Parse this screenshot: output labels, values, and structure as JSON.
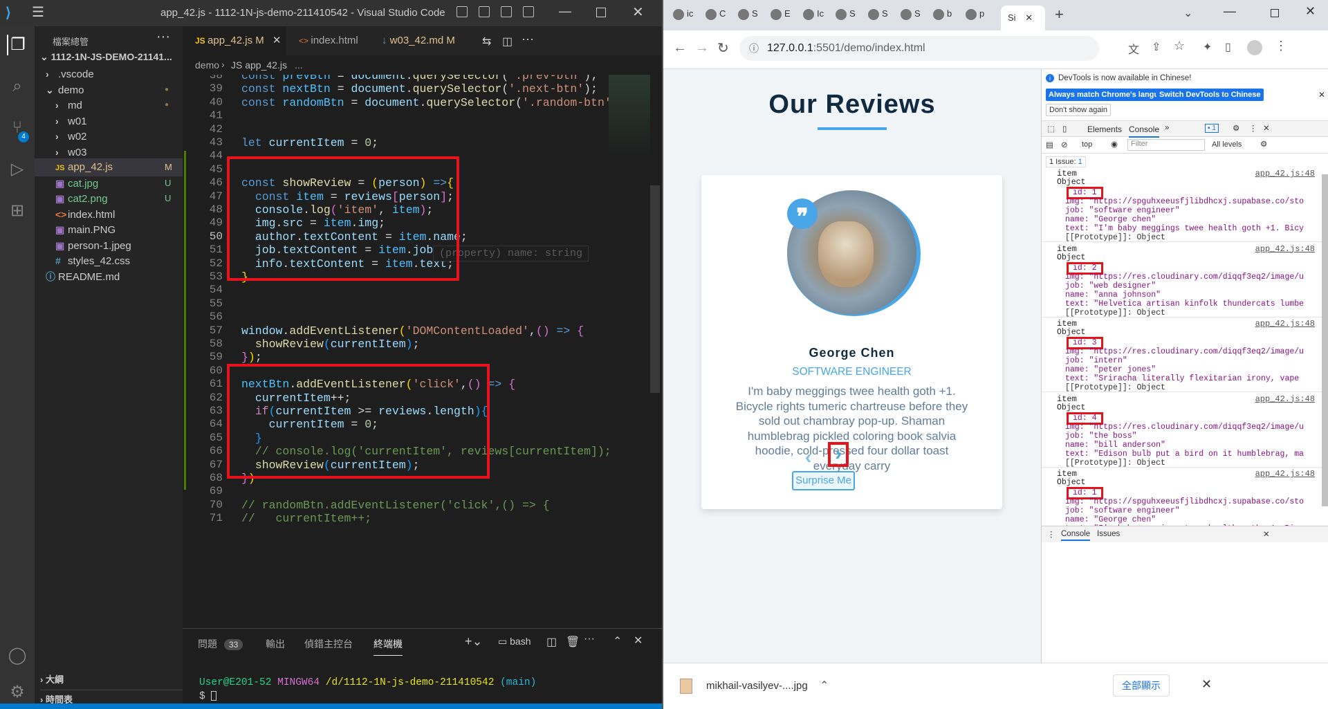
{
  "vscode": {
    "title": "app_42.js - 1112-1N-js-demo-211410542 - Visual Studio Code",
    "explorer_title": "檔案總管",
    "root_folder": "1112-1N-JS-DEMO-21141...",
    "tree": [
      {
        "name": ".vscode",
        "type": "folder",
        "indent": 1,
        "color": "#cccccc",
        "badge": ""
      },
      {
        "name": "demo",
        "type": "folder-open",
        "indent": 1,
        "color": "#cccccc",
        "badge": "●"
      },
      {
        "name": "md",
        "type": "folder",
        "indent": 2,
        "color": "#cccccc",
        "badge": "●"
      },
      {
        "name": "w01",
        "type": "folder",
        "indent": 2,
        "color": "#cccccc",
        "badge": ""
      },
      {
        "name": "w02",
        "type": "folder",
        "indent": 2,
        "color": "#cccccc",
        "badge": ""
      },
      {
        "name": "w03",
        "type": "folder",
        "indent": 2,
        "color": "#cccccc",
        "badge": ""
      },
      {
        "name": "app_42.js",
        "type": "js",
        "indent": 2,
        "color": "#e2c08d",
        "badge": "M"
      },
      {
        "name": "cat.jpg",
        "type": "img",
        "indent": 2,
        "color": "#73c991",
        "badge": "U"
      },
      {
        "name": "cat2.png",
        "type": "img",
        "indent": 2,
        "color": "#73c991",
        "badge": "U"
      },
      {
        "name": "index.html",
        "type": "html",
        "indent": 2,
        "color": "#cccccc",
        "badge": ""
      },
      {
        "name": "main.PNG",
        "type": "img",
        "indent": 2,
        "color": "#cccccc",
        "badge": ""
      },
      {
        "name": "person-1.jpeg",
        "type": "img",
        "indent": 2,
        "color": "#cccccc",
        "badge": ""
      },
      {
        "name": "styles_42.css",
        "type": "css",
        "indent": 2,
        "color": "#cccccc",
        "badge": ""
      },
      {
        "name": "README.md",
        "type": "info",
        "indent": 1,
        "color": "#cccccc",
        "badge": ""
      }
    ],
    "outline_label": "大綱",
    "timeline_label": "時間表",
    "scm_badge": "4",
    "tabs": [
      {
        "label": "app_42.js",
        "suffix": "M",
        "icon": "JS",
        "active": true
      },
      {
        "label": "index.html",
        "suffix": "",
        "icon": "<>",
        "active": false
      },
      {
        "label": "w03_42.md",
        "suffix": "M",
        "icon": "↓",
        "active": false
      }
    ],
    "breadcrumb": [
      "demo",
      "JS app_42.js",
      "..."
    ],
    "hover_hint": "(property) name: string",
    "panel_tabs": [
      "問題",
      "輸出",
      "偵錯主控台",
      "終端機"
    ],
    "problems_count": "33",
    "terminal_shell": "bash",
    "terminal_prompt_user": "User@E201-52",
    "terminal_prompt_env": "MINGW64",
    "terminal_prompt_path": "/d/1112-1N-js-demo-211410542",
    "terminal_prompt_branch": "(main)",
    "terminal_cursor_line": "$ "
  },
  "browser": {
    "url_host": "127.0.0.1",
    "url_rest": ":5501/demo/index.html",
    "tab_labels": [
      "ic",
      "C",
      "S",
      "E",
      "Ic",
      "S",
      "S",
      "S",
      "b",
      "p",
      "Si"
    ],
    "page": {
      "heading": "Our Reviews",
      "name": "George Chen",
      "job": "SOFTWARE ENGINEER",
      "text": "I'm baby meggings twee health goth +1. Bicycle rights tumeric chartreuse before they sold out chambray pop-up. Shaman humblebrag pickled coloring book salvia hoodie, cold-pressed four dollar toast everyday carry",
      "surprise_button": "Surprise Me",
      "prev_icon": "chevron-left",
      "next_icon": "chevron-right"
    },
    "devtools": {
      "notice": "DevTools is now available in Chinese!",
      "btn_match": "Always match Chrome's language",
      "btn_switch": "Switch DevTools to Chinese",
      "btn_dont": "Don't show again",
      "tabs": [
        "Elements",
        "Console"
      ],
      "issue_badge": "1",
      "context": "top",
      "filter_placeholder": "Filter",
      "levels": "All levels",
      "issues_bar": "1 Issue:",
      "issues_count": "1",
      "entries": [
        {
          "label": "item",
          "src": "app_42.js:48",
          "obj": "Object",
          "id": "id: 1",
          "img": "img: \"https://spguhxeeusfjlibdhcxj.supabase.co/sto",
          "job": "job: \"software engineer\"",
          "name": "name: \"George chen\"",
          "text": "text: \"I'm baby meggings twee health goth +1. Bicy",
          "proto": "[[Prototype]]: Object"
        },
        {
          "label": "item",
          "src": "app_42.js:48",
          "obj": "Object",
          "id": "id: 2",
          "img": "img: \"https://res.cloudinary.com/diqqf3eq2/image/u",
          "job": "job: \"web designer\"",
          "name": "name: \"anna johnson\"",
          "text": "text: \"Helvetica artisan kinfolk thundercats lumbe",
          "proto": "[[Prototype]]: Object"
        },
        {
          "label": "item",
          "src": "app_42.js:48",
          "obj": "Object",
          "id": "id: 3",
          "img": "img: \"https://res.cloudinary.com/diqqf3eq2/image/u",
          "job": "job: \"intern\"",
          "name": "name: \"peter jones\"",
          "text": "text: \"Sriracha literally flexitarian irony, vape",
          "proto": "[[Prototype]]: Object"
        },
        {
          "label": "item",
          "src": "app_42.js:48",
          "obj": "Object",
          "id": "id: 4",
          "img": "img: \"https://res.cloudinary.com/diqqf3eq2/image/u",
          "job": "job: \"the boss\"",
          "name": "name: \"bill anderson\"",
          "text": "text: \"Edison bulb put a bird on it humblebrag, ma",
          "proto": "[[Prototype]]: Object"
        },
        {
          "label": "item",
          "src": "app_42.js:48",
          "obj": "Object",
          "id": "id: 1",
          "img": "img: \"https://spguhxeeusfjlibdhcxj.supabase.co/sto",
          "job": "job: \"software engineer\"",
          "name": "name: \"George chen\"",
          "text": "text: \"I'm baby meggings twee health goth +1. Bicy",
          "proto": "[[Prototype]]: Object"
        }
      ],
      "drawer_tabs": [
        "Console",
        "Issues"
      ]
    },
    "download": {
      "filename": "mikhail-vasilyev-....jpg",
      "show_all": "全部顯示"
    }
  },
  "code_lines": [
    {
      "n": "38",
      "html": "<span class='kw'>const</span> <span class='ct'>prevBtn</span> = <span class='vr'>document</span>.<span class='fn'>querySelector</span>(<span class='st'>'.prev-btn'</span>);"
    },
    {
      "n": "39",
      "html": "<span class='kw'>const</span> <span class='ct'>nextBtn</span> = <span class='vr'>document</span>.<span class='fn'>querySelector</span>(<span class='st'>'.next-btn'</span>);"
    },
    {
      "n": "40",
      "html": "<span class='kw'>const</span> <span class='ct'>randomBtn</span> = <span class='vr'>document</span>.<span class='fn'>querySelector</span>(<span class='st'>'.random-btn'</span>)"
    },
    {
      "n": "41",
      "html": ""
    },
    {
      "n": "42",
      "html": ""
    },
    {
      "n": "43",
      "html": "<span class='kw'>let</span> <span class='vr'>currentItem</span> = <span class='nm'>0</span>;"
    },
    {
      "n": "44",
      "html": ""
    },
    {
      "n": "45",
      "html": ""
    },
    {
      "n": "46",
      "html": "<span class='kw'>const</span> <span class='fn'>showReview</span> = <span class='br'>(</span><span class='vr'>person</span><span class='br'>)</span> <span class='kw'>=&gt;</span><span class='br'>{</span>"
    },
    {
      "n": "47",
      "html": "  <span class='kw'>const</span> <span class='ct'>item</span> = <span class='vr'>reviews</span><span class='br2'>[</span><span class='vr'>person</span><span class='br2'>]</span>;"
    },
    {
      "n": "48",
      "html": "  <span class='vr'>console</span>.<span class='fn'>log</span><span class='br2'>(</span><span class='st'>'item'</span>, <span class='ct'>item</span><span class='br2'>)</span>;"
    },
    {
      "n": "49",
      "html": "  <span class='vr'>img</span>.<span class='vr'>src</span> = <span class='ct'>item</span>.<span class='vr'>img</span>;"
    },
    {
      "n": "50",
      "html": "  <span class='vr'>author</span>.<span class='vr'>textContent</span> = <span class='ct'>item</span>.<span class='vr'>name</span>;"
    },
    {
      "n": "51",
      "html": "  <span class='vr'>job</span>.<span class='vr'>textContent</span> = <span class='ct'>item</span>.<span class='vr'>job</span>;"
    },
    {
      "n": "52",
      "html": "  <span class='vr'>info</span>.<span class='vr'>textContent</span> = <span class='ct'>item</span>.<span class='vr'>text</span>;"
    },
    {
      "n": "53",
      "html": "<span class='br'>}</span>"
    },
    {
      "n": "54",
      "html": ""
    },
    {
      "n": "55",
      "html": ""
    },
    {
      "n": "56",
      "html": ""
    },
    {
      "n": "57",
      "html": "<span class='vr'>window</span>.<span class='fn'>addEventListener</span><span class='br'>(</span><span class='st'>'DOMContentLoaded'</span>,<span class='br2'>()</span> <span class='kw'>=&gt;</span> <span class='br2'>{</span>"
    },
    {
      "n": "58",
      "html": "  <span class='fn'>showReview</span><span class='br3'>(</span><span class='vr'>currentItem</span><span class='br3'>)</span>;"
    },
    {
      "n": "59",
      "html": "<span class='br2'>}</span><span class='br'>)</span>;"
    },
    {
      "n": "60",
      "html": ""
    },
    {
      "n": "61",
      "html": "<span class='ct'>nextBtn</span>.<span class='fn'>addEventListener</span><span class='br'>(</span><span class='st'>'click'</span>,<span class='br2'>()</span> <span class='kw'>=&gt;</span> <span class='br2'>{</span>"
    },
    {
      "n": "62",
      "html": "  <span class='vr'>currentItem</span>++;"
    },
    {
      "n": "63",
      "html": "  <span class='pu'>if</span><span class='br3'>(</span><span class='vr'>currentItem</span> &gt;= <span class='vr'>reviews</span>.<span class='vr'>length</span><span class='br3'>)</span><span class='br3'>{</span>"
    },
    {
      "n": "64",
      "html": "    <span class='vr'>currentItem</span> = <span class='nm'>0</span>;"
    },
    {
      "n": "65",
      "html": "  <span class='br3'>}</span>"
    },
    {
      "n": "66",
      "html": "  <span class='cm'>// console.log('currentItem', reviews[currentItem]);</span>"
    },
    {
      "n": "67",
      "html": "  <span class='fn'>showReview</span><span class='br3'>(</span><span class='vr'>currentItem</span><span class='br3'>)</span>;"
    },
    {
      "n": "68",
      "html": "<span class='br2'>}</span><span class='br'>)</span>"
    },
    {
      "n": "69",
      "html": ""
    },
    {
      "n": "70",
      "html": "<span class='cm'>// randomBtn.addEventListener('click',() =&gt; {</span>"
    },
    {
      "n": "71",
      "html": "<span class='cm'>//   currentItem++;</span>"
    }
  ]
}
